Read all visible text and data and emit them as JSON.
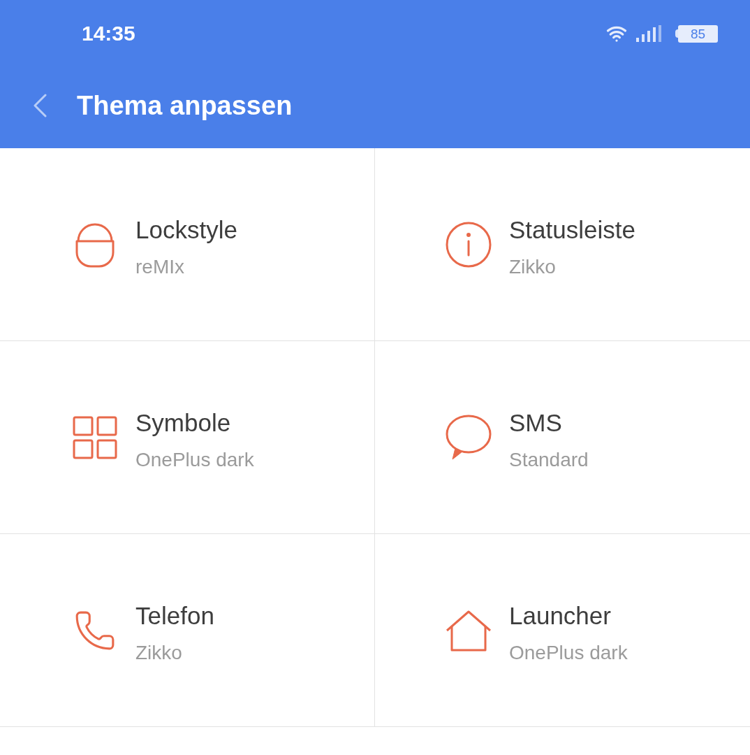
{
  "status_bar": {
    "time": "14:35",
    "battery": "85"
  },
  "app_bar": {
    "title": "Thema anpassen"
  },
  "items": [
    {
      "title": "Lockstyle",
      "value": "reMIx"
    },
    {
      "title": "Statusleiste",
      "value": "Zikko"
    },
    {
      "title": "Symbole",
      "value": "OnePlus dark"
    },
    {
      "title": "SMS",
      "value": "Standard"
    },
    {
      "title": "Telefon",
      "value": "Zikko"
    },
    {
      "title": "Launcher",
      "value": "OnePlus dark"
    }
  ]
}
